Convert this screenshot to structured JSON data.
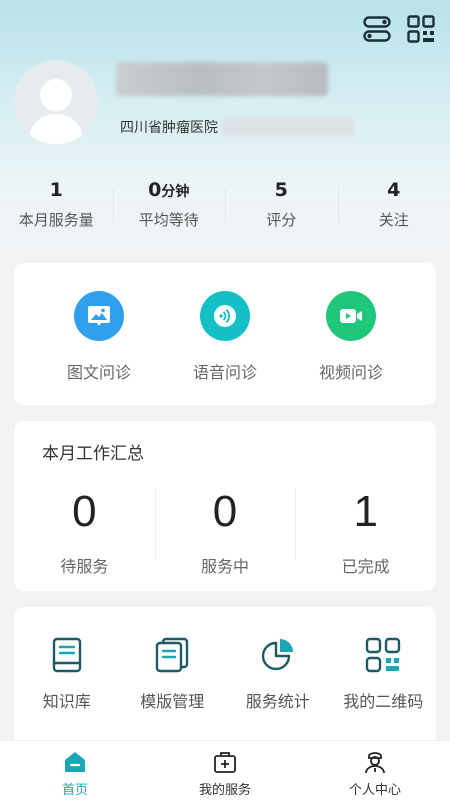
{
  "header": {
    "icons": [
      "toggle-icon",
      "qrcode-icon"
    ]
  },
  "profile": {
    "hospital": "四川省肿瘤医院"
  },
  "stats": [
    {
      "value": "1",
      "unit": "",
      "label": "本月服务量"
    },
    {
      "value": "0",
      "unit": "分钟",
      "label": "平均等待"
    },
    {
      "value": "5",
      "unit": "",
      "label": "评分"
    },
    {
      "value": "4",
      "unit": "",
      "label": "关注"
    }
  ],
  "consult": [
    {
      "label": "图文问诊",
      "icon": "image-chat-icon",
      "color": "#2fa0ec"
    },
    {
      "label": "语音问诊",
      "icon": "voice-icon",
      "color": "#14c0c6"
    },
    {
      "label": "视频问诊",
      "icon": "video-icon",
      "color": "#1ec77b"
    }
  ],
  "summary": {
    "title": "本月工作汇总",
    "items": [
      {
        "value": "0",
        "label": "待服务"
      },
      {
        "value": "0",
        "label": "服务中"
      },
      {
        "value": "1",
        "label": "已完成"
      }
    ]
  },
  "tools": [
    {
      "label": "知识库",
      "icon": "book-icon"
    },
    {
      "label": "模版管理",
      "icon": "template-icon"
    },
    {
      "label": "服务统计",
      "icon": "pie-chart-icon"
    },
    {
      "label": "我的二维码",
      "icon": "qrcode-icon"
    }
  ],
  "tabbar": [
    {
      "label": "首页",
      "icon": "home-icon",
      "active": true
    },
    {
      "label": "我的服务",
      "icon": "medical-kit-icon",
      "active": false
    },
    {
      "label": "个人中心",
      "icon": "doctor-icon",
      "active": false
    }
  ],
  "colors": {
    "accent": "#1aa6b7",
    "dark_teal": "#1d5a63"
  }
}
